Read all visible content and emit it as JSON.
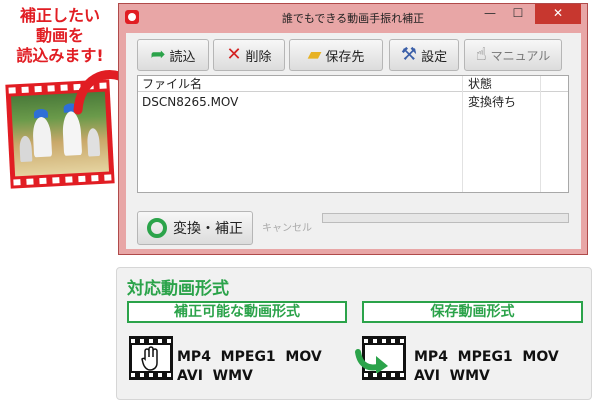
{
  "promo": {
    "line1": "補正したい",
    "line2": "動画を",
    "line3": "読込みます!"
  },
  "window": {
    "title": "誰でもできる動画手振れ補正",
    "controls": {
      "minimize": "—",
      "maximize": "☐",
      "close": "✕"
    }
  },
  "toolbar": {
    "load_label": "読込",
    "delete_label": "削除",
    "save_dest_label": "保存先",
    "settings_label": "設定",
    "manual_label": "マニュアル"
  },
  "file_list": {
    "columns": [
      "ファイル名",
      "状態"
    ],
    "rows": [
      {
        "filename": "DSCN8265.MOV",
        "status": "変換待ち"
      }
    ]
  },
  "actions": {
    "convert_label": "変換・補正",
    "cancel_label": "キャンセル"
  },
  "formats": {
    "title": "対応動画形式",
    "input_title": "補正可能な動画形式",
    "output_title": "保存動画形式",
    "input_line1": "MP4  MPEG1  MOV",
    "input_line2": "AVI  WMV",
    "output_line1": "MP4  MPEG1  MOV",
    "output_line2": "AVI  WMV"
  },
  "icons": {
    "load": "arrow-right-icon",
    "delete": "x-icon",
    "save_dest": "folder-icon",
    "settings": "tools-icon",
    "manual": "hand-pointer-icon",
    "convert": "ring-icon"
  },
  "colors": {
    "brand_red": "#e11d23",
    "accent_green": "#2ba34a",
    "window_frame": "#e8a6a6"
  }
}
